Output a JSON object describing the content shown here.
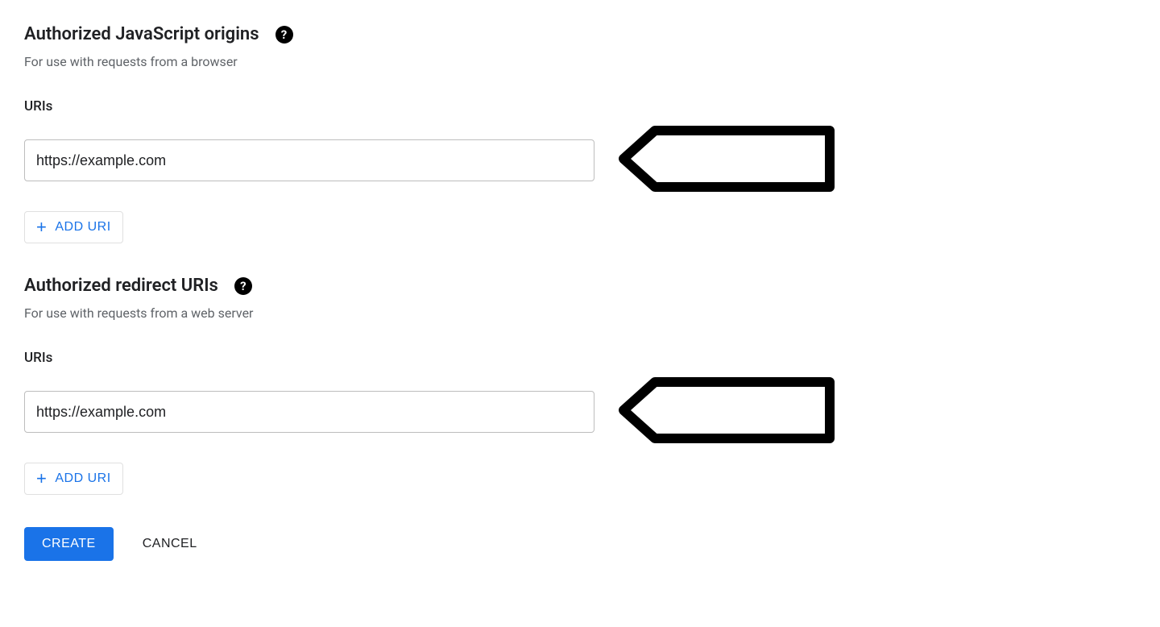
{
  "sections": {
    "js_origins": {
      "title": "Authorized JavaScript origins",
      "subtitle": "For use with requests from a browser",
      "field_label": "URIs",
      "input_value": "https://example.com",
      "add_button_label": "ADD URI"
    },
    "redirect_uris": {
      "title": "Authorized redirect URIs",
      "subtitle": "For use with requests from a web server",
      "field_label": "URIs",
      "input_value": "https://example.com",
      "add_button_label": "ADD URI"
    }
  },
  "buttons": {
    "create": "CREATE",
    "cancel": "CANCEL"
  }
}
